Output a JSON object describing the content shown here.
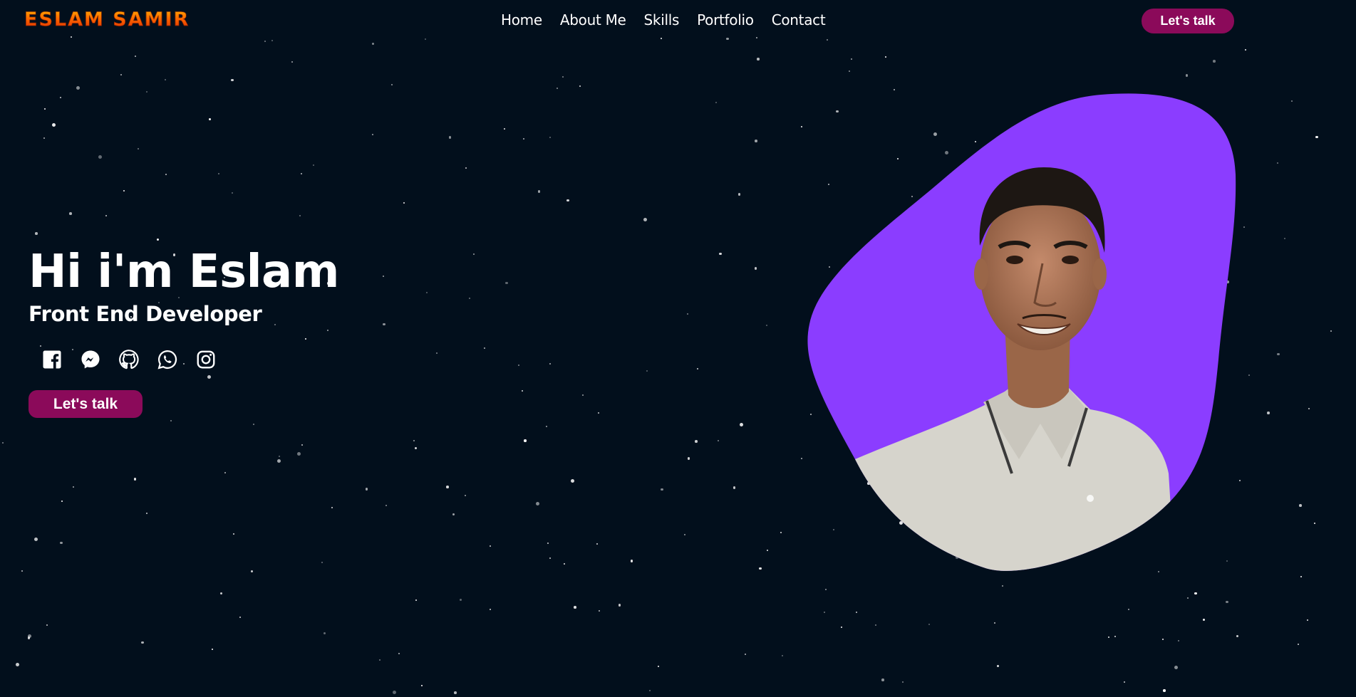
{
  "brand": {
    "logo_text": "ESLAM SAMIR"
  },
  "nav": {
    "items": [
      {
        "label": "Home"
      },
      {
        "label": "About Me"
      },
      {
        "label": "Skills"
      },
      {
        "label": "Portfolio"
      },
      {
        "label": "Contact"
      }
    ],
    "cta_label": "Let's talk"
  },
  "hero": {
    "title": "Hi i'm Eslam",
    "subtitle": "Front End Developer",
    "cta_label": "Let's talk",
    "socials": [
      {
        "icon": "facebook-icon"
      },
      {
        "icon": "messenger-icon"
      },
      {
        "icon": "github-icon"
      },
      {
        "icon": "whatsapp-icon"
      },
      {
        "icon": "instagram-icon"
      }
    ]
  },
  "colors": {
    "background": "#020f1c",
    "accent_button": "#8b0a5a",
    "blob": "#8b3dff",
    "logo_gradient": [
      "#ffb300",
      "#ff6a00",
      "#d62800"
    ]
  }
}
